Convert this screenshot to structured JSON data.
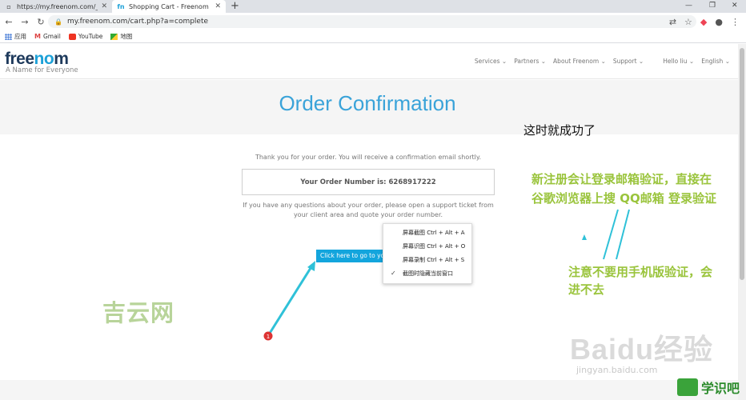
{
  "browser": {
    "tabs": [
      {
        "title": "https://my.freenom.com/_最美",
        "active": false
      },
      {
        "title": "Shopping Cart - Freenom",
        "active": true
      }
    ],
    "url": "my.freenom.com/cart.php?a=complete",
    "bookmarks": [
      {
        "label": "应用",
        "icon": "apps-grid-icon"
      },
      {
        "label": "Gmail",
        "icon": "gmail-icon"
      },
      {
        "label": "YouTube",
        "icon": "youtube-icon"
      },
      {
        "label": "地图",
        "icon": "maps-icon"
      }
    ]
  },
  "site": {
    "logo_part1": "free",
    "logo_part2": "no",
    "logo_part3": "m",
    "tagline": "A Name for Everyone",
    "nav": [
      "Services",
      "Partners",
      "About Freenom",
      "Support",
      "Hello liu",
      "English"
    ],
    "page_title": "Order Confirmation",
    "thanks": "Thank you for your order. You will receive a confirmation email shortly.",
    "order_number": "Your Order Number is: 6268917222",
    "question": "If you have any questions about your order, please open a support ticket from your client area and quote your order number.",
    "cta": "Click here to go to your"
  },
  "context_menu": {
    "items": [
      {
        "label": "屏幕截图 Ctrl + Alt + A",
        "checked": false
      },
      {
        "label": "屏幕识图 Ctrl + Alt + O",
        "checked": false
      },
      {
        "label": "屏幕录制 Ctrl + Alt + S",
        "checked": false
      },
      {
        "label": "截图时隐藏当前窗口",
        "checked": true
      }
    ]
  },
  "annotations": {
    "success": "这时就成功了",
    "email_line1": "新注册会让登录邮箱验证，直接在",
    "email_line2": "谷歌浏览器上搜 QQ邮箱 登录验证",
    "mobile_line1": "注意不要用手机版验证，会",
    "mobile_line2": "进不去",
    "step_marker": "1"
  },
  "watermarks": {
    "jiyun": "吉云网",
    "baidu": "Baidu经验",
    "baidu_url": "jingyan.baidu.com",
    "xueshiba": "学识吧"
  },
  "colors": {
    "accent": "#3aa3d9",
    "annotation_green": "#9ac43c",
    "arrow": "#2fc1d8"
  }
}
